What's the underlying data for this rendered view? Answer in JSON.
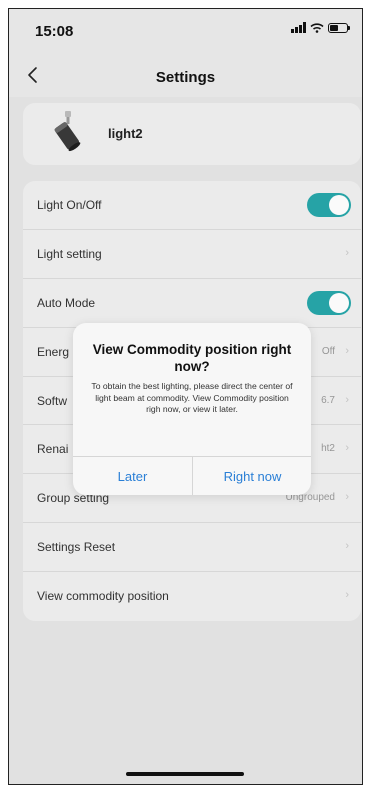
{
  "status": {
    "time": "15:08"
  },
  "nav": {
    "title": "Settings"
  },
  "device": {
    "name": "light2"
  },
  "settings": [
    {
      "label": "Light On/Off",
      "value": "",
      "toggle": true
    },
    {
      "label": "Light setting",
      "value": "",
      "toggle": false
    },
    {
      "label": "Auto Mode",
      "value": "",
      "toggle": true
    },
    {
      "label": "Energ",
      "value": "Off",
      "toggle": false
    },
    {
      "label": "Softw",
      "value": "6.7",
      "toggle": false
    },
    {
      "label": "Renai",
      "value": "ht2",
      "toggle": false
    },
    {
      "label": "Group setting",
      "value": "Ungrouped",
      "toggle": false
    },
    {
      "label": "Settings Reset",
      "value": "",
      "toggle": false
    },
    {
      "label": "View commodity position",
      "value": "",
      "toggle": false
    }
  ],
  "dialog": {
    "title": "View Commodity position right now?",
    "message": "To obtain the best lighting, please direct the center of light beam at commodity. View Commodity position righ now, or view it later.",
    "later_label": "Later",
    "right_now_label": "Right now"
  },
  "colors": {
    "accent": "#27a7aa",
    "link": "#2a7fd6"
  }
}
